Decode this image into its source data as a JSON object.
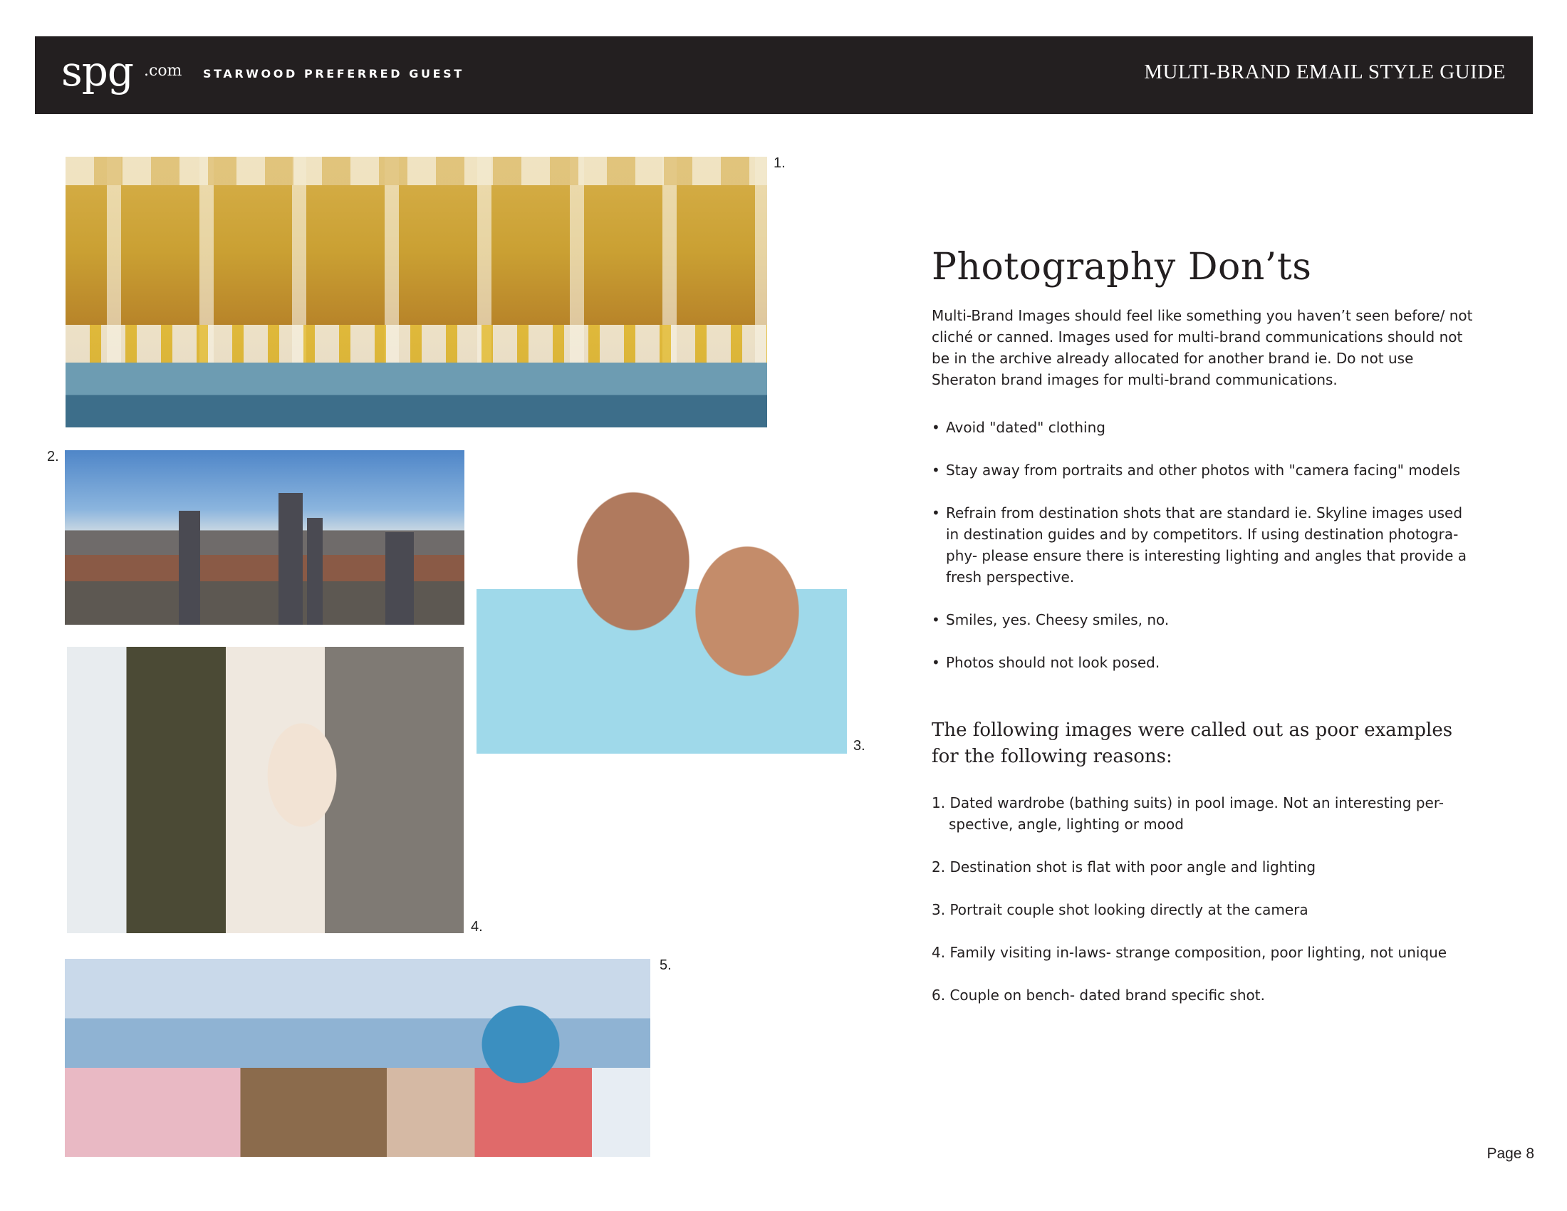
{
  "header": {
    "logo": "spg",
    "logo_suffix": ".com",
    "brand_name": "STARWOOD PREFERRED GUEST",
    "document_title": "MULTI-BRAND EMAIL STYLE GUIDE"
  },
  "images": [
    {
      "caption": "1."
    },
    {
      "caption": "2."
    },
    {
      "caption": "3."
    },
    {
      "caption": "4."
    },
    {
      "caption": "5."
    }
  ],
  "content": {
    "heading": "Photography Don’ts",
    "intro": "Multi-Brand Images should feel like something you haven’t seen before/ not cliché or canned. Images used for multi-brand communications should not be in the archive already allocated for another brand ie. Do not use Sheraton brand images for multi-brand communications.",
    "bullets": [
      "Avoid \"dated\" clothing",
      "Stay away from portraits and other photos with \"camera facing\" models",
      "Refrain from destination shots that are standard ie. Skyline images used in destination guides and by competitors. If using destination photogra-phy- please ensure there is interesting lighting and angles that provide a fresh perspective.",
      "Smiles, yes. Cheesy smiles, no.",
      "Photos should not look posed."
    ],
    "subheading": "The following images were called out as poor examples for the following reasons:",
    "reasons": [
      "1. Dated wardrobe (bathing suits) in pool image. Not an interesting per-spective, angle, lighting or mood",
      "2. Destination shot is flat with poor angle and lighting",
      "3. Portrait couple shot looking directly at the camera",
      "4. Family visiting in-laws- strange composition, poor lighting, not unique",
      "6. Couple on bench- dated brand specific shot."
    ]
  },
  "footer": {
    "page_label": "Page 8"
  }
}
